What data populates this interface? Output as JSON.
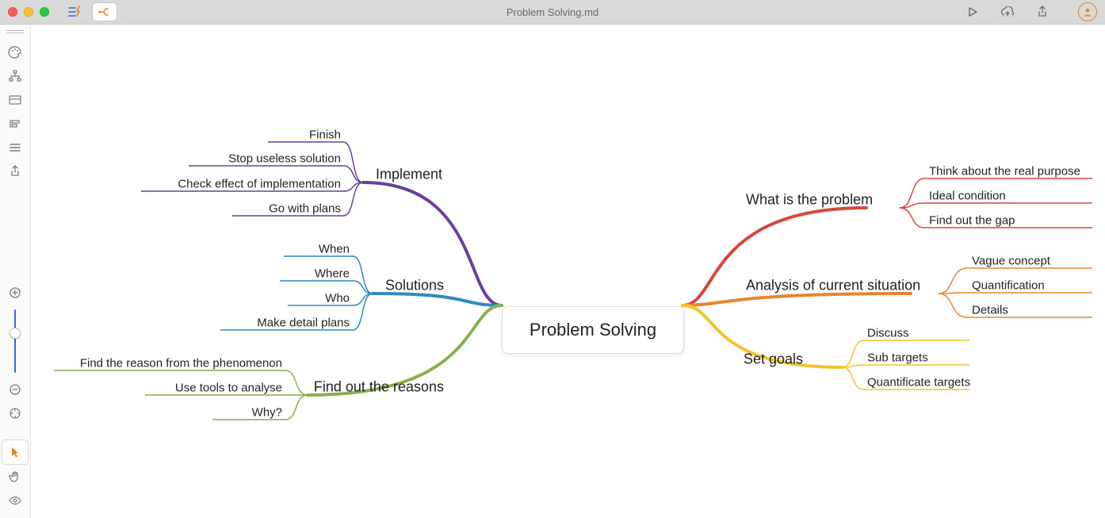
{
  "titlebar": {
    "doc_title": "Problem Solving.md"
  },
  "mindmap": {
    "center": "Problem Solving",
    "right": [
      {
        "label": "What is the problem",
        "color": "#d9463a",
        "children": [
          "Think about the real purpose",
          "Ideal condition",
          "Find out the gap"
        ]
      },
      {
        "label": "Analysis of current situation",
        "color": "#e8862e",
        "children": [
          "Vague concept",
          "Quantification",
          "Details"
        ]
      },
      {
        "label": "Set goals",
        "color": "#f2c230",
        "children": [
          "Discuss",
          "Sub targets",
          "Quantificate targets"
        ]
      }
    ],
    "left": [
      {
        "label": "Implement",
        "color": "#6a3fa0",
        "children": [
          "Finish",
          "Stop useless solution",
          "Check effect of implementation",
          "Go with plans"
        ]
      },
      {
        "label": "Solutions",
        "color": "#2e8bc0",
        "children": [
          "When",
          "Where",
          "Who",
          "Make detail plans"
        ]
      },
      {
        "label": "Find out the reasons",
        "color": "#88b04b",
        "children": [
          "Find the reason from the phenomenon",
          "Use tools to analyse",
          "Why?"
        ]
      }
    ]
  }
}
